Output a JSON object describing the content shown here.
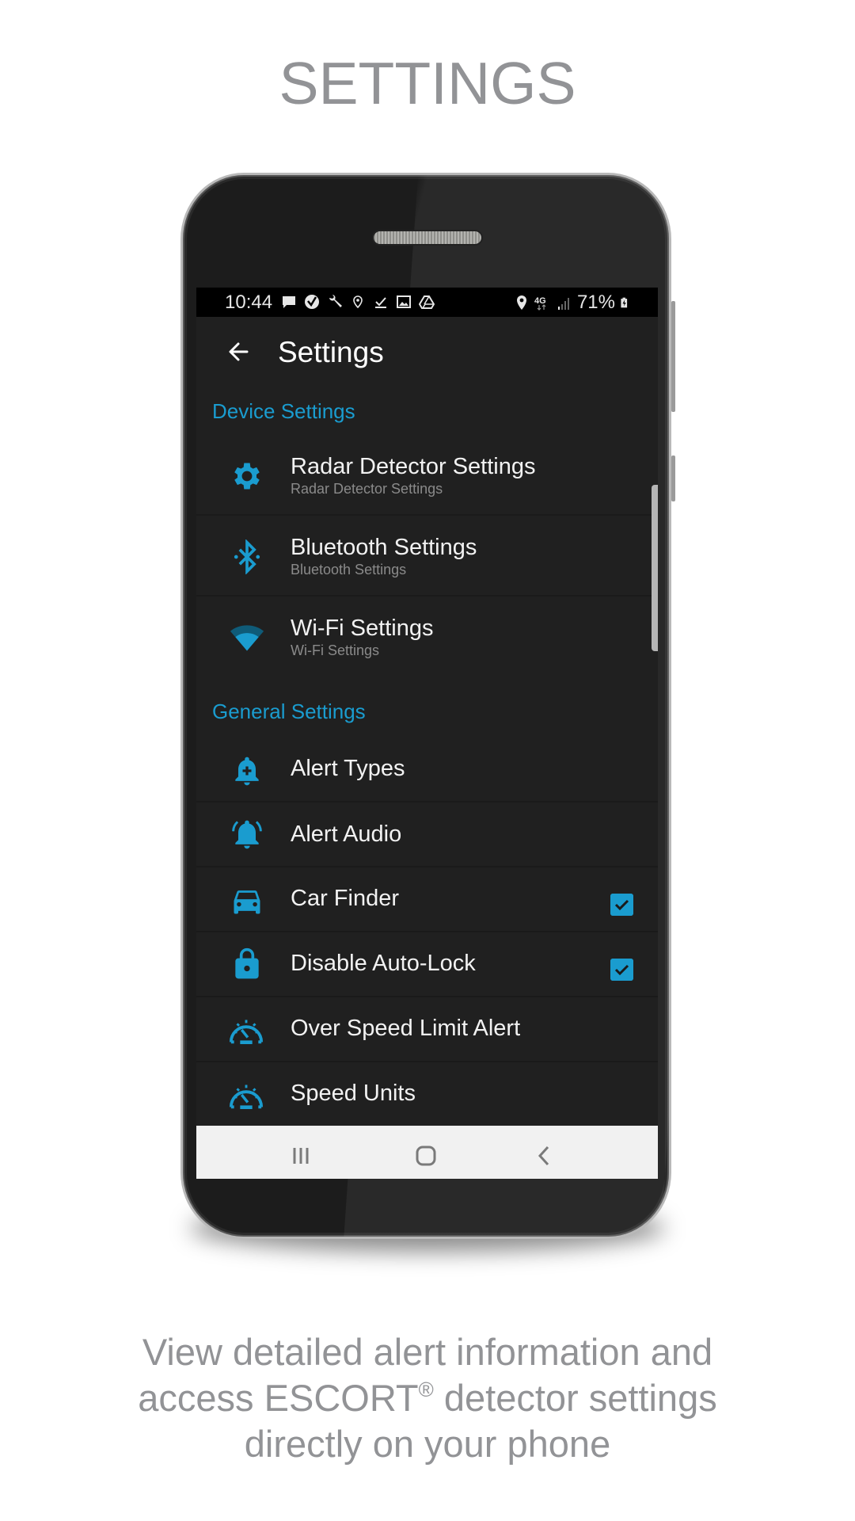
{
  "headline": "SETTINGS",
  "caption": {
    "line1": "View detailed alert information and",
    "line2_pre": "access ESCORT",
    "line2_reg": "®",
    "line2_post": " detector settings",
    "line3": "directly on your phone"
  },
  "colors": {
    "accent": "#1a9ccf",
    "screen_bg": "#202020",
    "headline_gray": "#929396"
  },
  "status_bar": {
    "time": "10:44",
    "left_icons": [
      "message-icon",
      "verizon-check-icon",
      "wrench-icon",
      "location-pin-small-icon",
      "download-done-icon",
      "image-icon",
      "drive-icon"
    ],
    "right_icons": [
      "location-icon",
      "4g-lte-icon",
      "signal-icon"
    ],
    "network": "4G",
    "battery": "71%"
  },
  "app_bar": {
    "title": "Settings",
    "back_icon": "arrow-left-icon"
  },
  "sections": [
    {
      "title": "Device Settings",
      "items": [
        {
          "icon": "gear-icon",
          "title": "Radar Detector Settings",
          "subtitle": "Radar Detector Settings"
        },
        {
          "icon": "bluetooth-icon",
          "title": "Bluetooth Settings",
          "subtitle": "Bluetooth Settings"
        },
        {
          "icon": "wifi-icon",
          "title": "Wi-Fi Settings",
          "subtitle": "Wi-Fi Settings"
        }
      ]
    },
    {
      "title": "General Settings",
      "items": [
        {
          "icon": "bell-plus-icon",
          "title": "Alert Types"
        },
        {
          "icon": "bell-ringing-icon",
          "title": "Alert Audio"
        },
        {
          "icon": "car-icon",
          "title": "Car Finder",
          "checked": true
        },
        {
          "icon": "lock-icon",
          "title": "Disable Auto-Lock",
          "checked": true
        },
        {
          "icon": "speedometer-icon",
          "title": "Over Speed Limit Alert"
        },
        {
          "icon": "speedometer-icon",
          "title": "Speed Units"
        }
      ]
    }
  ],
  "nav_bar": {
    "recents": "recents-icon",
    "home": "home-icon",
    "back": "back-chevron-icon"
  }
}
